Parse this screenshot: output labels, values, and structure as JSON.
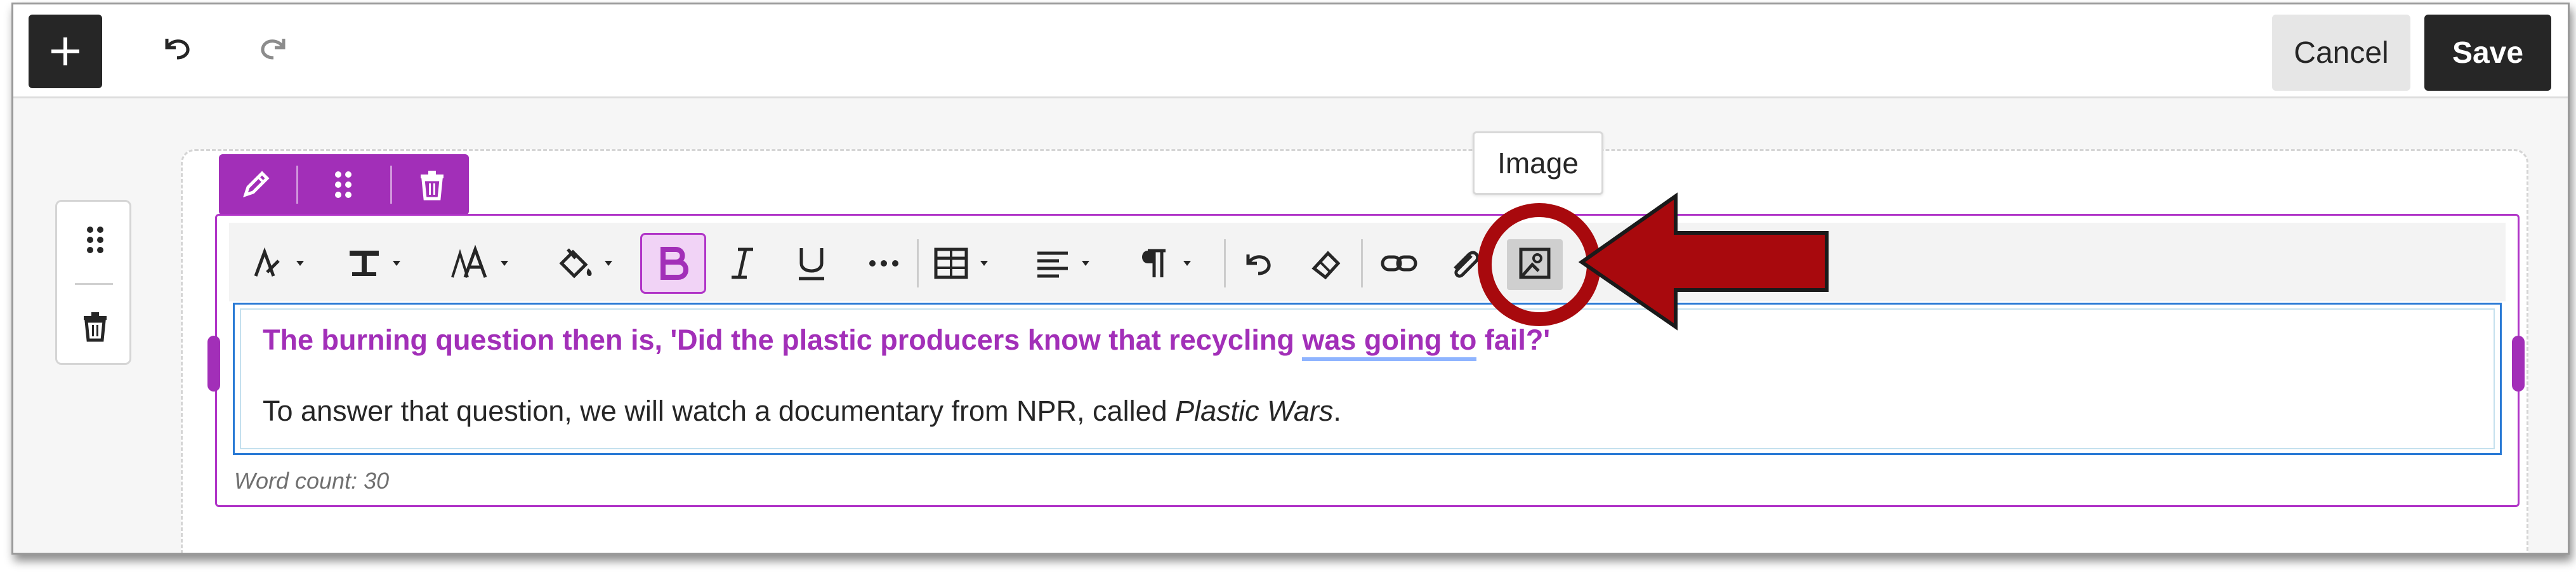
{
  "topbar": {
    "cancel_label": "Cancel",
    "save_label": "Save",
    "icons": [
      "plus-icon",
      "undo-icon",
      "redo-icon"
    ]
  },
  "block_toolbar": {
    "icons": [
      "pencil-icon",
      "drag-handle-icon",
      "trash-icon"
    ]
  },
  "side_tools": {
    "icons": [
      "drag-handle-icon",
      "trash-icon"
    ]
  },
  "format_toolbar": {
    "items": [
      "font-style-icon",
      "text-format-icon",
      "font-size-icon",
      "paint-bucket-icon",
      "bold-icon",
      "italic-icon",
      "underline-icon",
      "more-icon",
      "table-icon",
      "align-icon",
      "paragraph-icon",
      "undo-icon",
      "eraser-icon",
      "link-icon",
      "attachment-icon",
      "image-icon"
    ],
    "active": "bold-icon"
  },
  "tooltip": {
    "label": "Image"
  },
  "editor": {
    "p1_before": "The burning question then is, 'Did the plastic producers know that recycling ",
    "p1_underlined": "was going to",
    "p1_after": " fail?'",
    "p2_before": "To answer that question, we will watch a documentary from NPR, called ",
    "p2_italic": "Plastic Wars",
    "p2_after": ".",
    "word_count": "Word count: 30"
  },
  "colors": {
    "accent": "#a22fb8",
    "dark": "#262626",
    "annotation_red": "#a8090d"
  }
}
